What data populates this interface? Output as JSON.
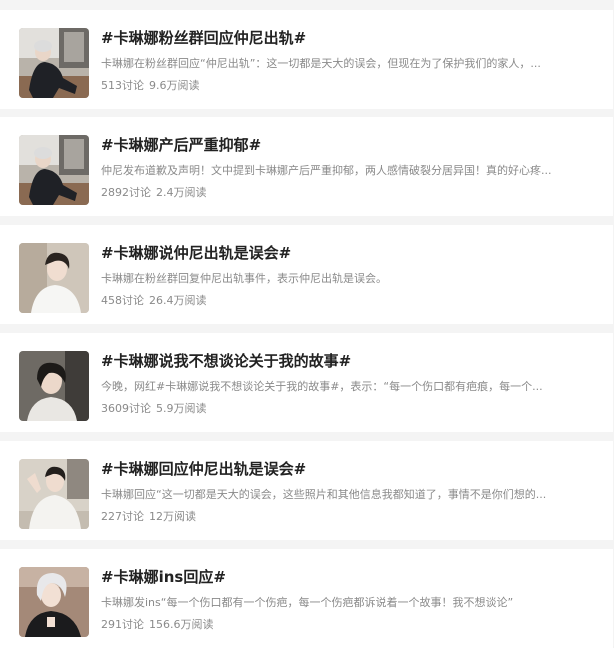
{
  "topics": [
    {
      "title": "#卡琳娜粉丝群回应仲尼出轨#",
      "summary": "卡琳娜在粉丝群回应“仲尼出轨”：这一切都是天大的误会，但现在为了保护我们的家人，...",
      "discussions": "513讨论",
      "reads": "9.6万阅读",
      "thumb_icon": "man-in-suit-photo"
    },
    {
      "title": "#卡琳娜产后严重抑郁#",
      "summary": "仲尼发布道歉及声明！文中提到卡琳娜产后严重抑郁，两人感情破裂分居异国！真的好心疼...",
      "discussions": "2892讨论",
      "reads": "2.4万阅读",
      "thumb_icon": "man-in-suit-photo"
    },
    {
      "title": "#卡琳娜说仲尼出轨是误会#",
      "summary": "卡琳娜在粉丝群回复仲尼出轨事件，表示仲尼出轨是误会。",
      "discussions": "458讨论",
      "reads": "26.4万阅读",
      "thumb_icon": "man-white-shirt-photo"
    },
    {
      "title": "#卡琳娜说我不想谈论关于我的故事#",
      "summary": "今晚，网红#卡琳娜说我不想谈论关于我的故事#，表示：“每一个伤口都有疤痕，每一个...",
      "discussions": "3609讨论",
      "reads": "5.9万阅读",
      "thumb_icon": "portrait-photo"
    },
    {
      "title": "#卡琳娜回应仲尼出轨是误会#",
      "summary": "卡琳娜回应“这一切都是天大的误会，这些照片和其他信息我都知道了，事情不是你们想的...",
      "discussions": "227讨论",
      "reads": "12万阅读",
      "thumb_icon": "man-posing-photo"
    },
    {
      "title": "#卡琳娜ins回应#",
      "summary": "卡琳娜发ins“每一个伤口都有一个伤疤，每一个伤疤都诉说着一个故事！我不想谈论”",
      "discussions": "291讨论",
      "reads": "156.6万阅读",
      "thumb_icon": "silver-hair-portrait-photo"
    }
  ]
}
